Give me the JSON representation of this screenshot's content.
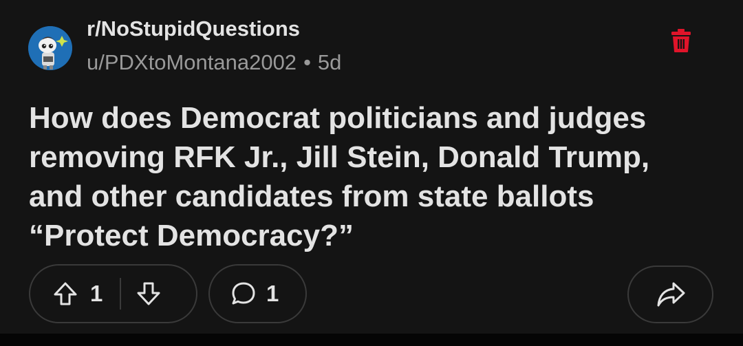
{
  "post": {
    "subreddit": "r/NoStupidQuestions",
    "author": "u/PDXtoMontana2002",
    "separator": "•",
    "age": "5d",
    "title": "How does Democrat politicians and judges removing RFK Jr., Jill Stein, Donald Trump, and other candidates from state ballots “Protect Democracy?”",
    "avatar_icon": "snoo-avatar-icon",
    "delete_icon": "trash-icon"
  },
  "actions": {
    "upvote_icon": "arrow-up-icon",
    "vote_count": "1",
    "downvote_icon": "arrow-down-icon",
    "comment_icon": "speech-bubble-icon",
    "comment_count": "1",
    "share_icon": "share-arrow-icon"
  },
  "colors": {
    "background": "#141414",
    "text_primary": "#e3e3e3",
    "text_secondary": "#9a9a9a",
    "delete_red": "#e0142a",
    "avatar_blue": "#1f6fb6",
    "pill_border": "#3a3a3a"
  }
}
